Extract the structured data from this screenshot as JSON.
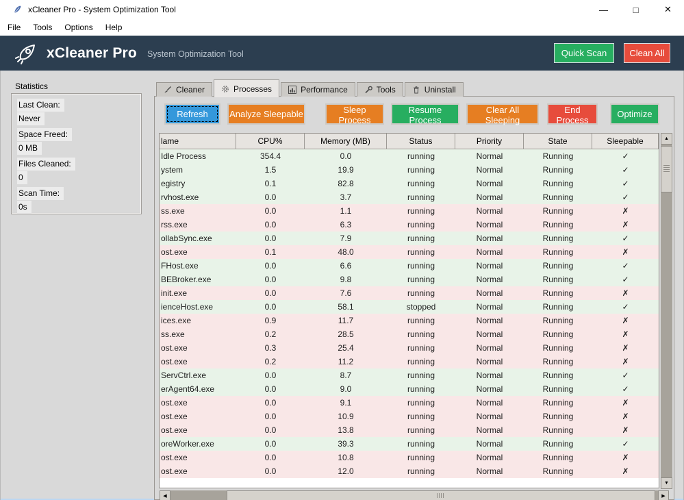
{
  "window": {
    "title": "xCleaner Pro - System Optimization Tool",
    "minimize_glyph": "—",
    "maximize_glyph": "□",
    "close_glyph": "✕"
  },
  "menu": [
    "File",
    "Tools",
    "Options",
    "Help"
  ],
  "header": {
    "app_name": "xCleaner Pro",
    "subtitle": "System Optimization Tool",
    "quick_scan_label": "Quick Scan",
    "clean_all_label": "Clean All"
  },
  "statistics": {
    "title": "Statistics",
    "items": [
      {
        "label": "Last Clean:",
        "value": "Never"
      },
      {
        "label": "Space Freed:",
        "value": "0 MB"
      },
      {
        "label": "Files Cleaned:",
        "value": "0"
      },
      {
        "label": "Scan Time:",
        "value": "0s"
      }
    ]
  },
  "tabs": [
    {
      "label": "Cleaner",
      "icon": "brush-icon",
      "active": false
    },
    {
      "label": "Processes",
      "icon": "gear-icon",
      "active": true
    },
    {
      "label": "Performance",
      "icon": "chart-icon",
      "active": false
    },
    {
      "label": "Tools",
      "icon": "wrench-icon",
      "active": false
    },
    {
      "label": "Uninstall",
      "icon": "trash-icon",
      "active": false
    }
  ],
  "toolbar": {
    "buttons": [
      {
        "name": "refresh-button",
        "label": "Refresh",
        "color": "#3498db",
        "focused": true
      },
      {
        "name": "analyze-sleepable-button",
        "label": "Analyze Sleepable",
        "color": "#e67e22",
        "focused": false
      },
      {
        "name": "sleep-process-button",
        "label": "Sleep Process",
        "color": "#e67e22",
        "focused": false
      },
      {
        "name": "resume-process-button",
        "label": "Resume Process",
        "color": "#27ae60",
        "focused": false
      },
      {
        "name": "clear-all-sleeping-button",
        "label": "Clear All Sleeping",
        "color": "#e67e22",
        "focused": false
      },
      {
        "name": "end-process-button",
        "label": "End Process",
        "color": "#e74c3c",
        "focused": false
      },
      {
        "name": "optimize-button",
        "label": "Optimize",
        "color": "#27ae60",
        "focused": false
      }
    ]
  },
  "table": {
    "columns": [
      "lame",
      "CPU%",
      "Memory (MB)",
      "Status",
      "Priority",
      "State",
      "Sleepable"
    ],
    "check_glyph": "✓",
    "cross_glyph": "✗",
    "rows": [
      {
        "name": "Idle Process",
        "cpu": "354.4",
        "memory": "0.0",
        "status": "running",
        "priority": "Normal",
        "state": "Running",
        "sleepable": "✓"
      },
      {
        "name": "ystem",
        "cpu": "1.5",
        "memory": "19.9",
        "status": "running",
        "priority": "Normal",
        "state": "Running",
        "sleepable": "✓"
      },
      {
        "name": "egistry",
        "cpu": "0.1",
        "memory": "82.8",
        "status": "running",
        "priority": "Normal",
        "state": "Running",
        "sleepable": "✓"
      },
      {
        "name": "rvhost.exe",
        "cpu": "0.0",
        "memory": "3.7",
        "status": "running",
        "priority": "Normal",
        "state": "Running",
        "sleepable": "✓"
      },
      {
        "name": "ss.exe",
        "cpu": "0.0",
        "memory": "1.1",
        "status": "running",
        "priority": "Normal",
        "state": "Running",
        "sleepable": "✗"
      },
      {
        "name": "rss.exe",
        "cpu": "0.0",
        "memory": "6.3",
        "status": "running",
        "priority": "Normal",
        "state": "Running",
        "sleepable": "✗"
      },
      {
        "name": "ollabSync.exe",
        "cpu": "0.0",
        "memory": "7.9",
        "status": "running",
        "priority": "Normal",
        "state": "Running",
        "sleepable": "✓"
      },
      {
        "name": "ost.exe",
        "cpu": "0.1",
        "memory": "48.0",
        "status": "running",
        "priority": "Normal",
        "state": "Running",
        "sleepable": "✗"
      },
      {
        "name": "FHost.exe",
        "cpu": "0.0",
        "memory": "6.6",
        "status": "running",
        "priority": "Normal",
        "state": "Running",
        "sleepable": "✓"
      },
      {
        "name": "BEBroker.exe",
        "cpu": "0.0",
        "memory": "9.8",
        "status": "running",
        "priority": "Normal",
        "state": "Running",
        "sleepable": "✓"
      },
      {
        "name": "init.exe",
        "cpu": "0.0",
        "memory": "7.6",
        "status": "running",
        "priority": "Normal",
        "state": "Running",
        "sleepable": "✗"
      },
      {
        "name": "ienceHost.exe",
        "cpu": "0.0",
        "memory": "58.1",
        "status": "stopped",
        "priority": "Normal",
        "state": "Running",
        "sleepable": "✓"
      },
      {
        "name": "ices.exe",
        "cpu": "0.9",
        "memory": "11.7",
        "status": "running",
        "priority": "Normal",
        "state": "Running",
        "sleepable": "✗"
      },
      {
        "name": "ss.exe",
        "cpu": "0.2",
        "memory": "28.5",
        "status": "running",
        "priority": "Normal",
        "state": "Running",
        "sleepable": "✗"
      },
      {
        "name": "ost.exe",
        "cpu": "0.3",
        "memory": "25.4",
        "status": "running",
        "priority": "Normal",
        "state": "Running",
        "sleepable": "✗"
      },
      {
        "name": "ost.exe",
        "cpu": "0.2",
        "memory": "11.2",
        "status": "running",
        "priority": "Normal",
        "state": "Running",
        "sleepable": "✗"
      },
      {
        "name": "ServCtrl.exe",
        "cpu": "0.0",
        "memory": "8.7",
        "status": "running",
        "priority": "Normal",
        "state": "Running",
        "sleepable": "✓"
      },
      {
        "name": "erAgent64.exe",
        "cpu": "0.0",
        "memory": "9.0",
        "status": "running",
        "priority": "Normal",
        "state": "Running",
        "sleepable": "✓"
      },
      {
        "name": "ost.exe",
        "cpu": "0.0",
        "memory": "9.1",
        "status": "running",
        "priority": "Normal",
        "state": "Running",
        "sleepable": "✗"
      },
      {
        "name": "ost.exe",
        "cpu": "0.0",
        "memory": "10.9",
        "status": "running",
        "priority": "Normal",
        "state": "Running",
        "sleepable": "✗"
      },
      {
        "name": "ost.exe",
        "cpu": "0.0",
        "memory": "13.8",
        "status": "running",
        "priority": "Normal",
        "state": "Running",
        "sleepable": "✗"
      },
      {
        "name": "oreWorker.exe",
        "cpu": "0.0",
        "memory": "39.3",
        "status": "running",
        "priority": "Normal",
        "state": "Running",
        "sleepable": "✓"
      },
      {
        "name": "ost.exe",
        "cpu": "0.0",
        "memory": "10.8",
        "status": "running",
        "priority": "Normal",
        "state": "Running",
        "sleepable": "✗"
      },
      {
        "name": "ost.exe",
        "cpu": "0.0",
        "memory": "12.0",
        "status": "running",
        "priority": "Normal",
        "state": "Running",
        "sleepable": "✗"
      }
    ]
  },
  "scrollbars": {
    "up_glyph": "▲",
    "down_glyph": "▼",
    "left_glyph": "◀",
    "right_glyph": "▶"
  },
  "colors": {
    "header_bg": "#2c3e50",
    "accent_blue": "#3498db",
    "accent_orange": "#e67e22",
    "accent_green": "#27ae60",
    "accent_red": "#e74c3c",
    "row_sleepable": "#e8f3e8",
    "row_not_sleepable": "#f9e7e7",
    "scroll_trough": "#a7a39b"
  }
}
